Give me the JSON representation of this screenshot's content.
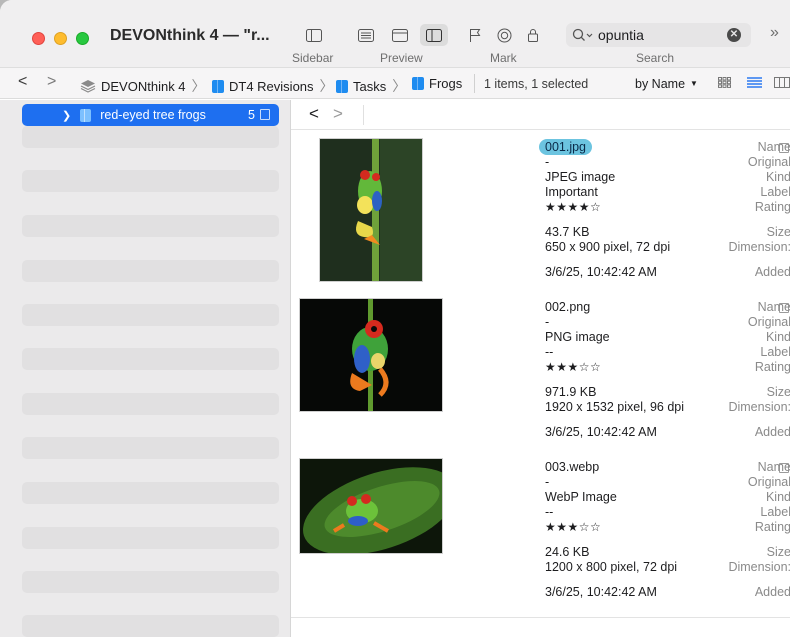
{
  "window": {
    "title": "DEVONthink 4 — \"r..."
  },
  "toolbar": {
    "sidebar_label": "Sidebar",
    "preview_label": "Preview",
    "mark_label": "Mark",
    "search_label": "Search",
    "search_value": "opuntia"
  },
  "pathbar": {
    "crumbs": [
      "DEVONthink 4",
      "DT4 Revisions",
      "Tasks",
      "Frogs"
    ],
    "count": "1 items, 1 selected",
    "sort": "by Name"
  },
  "sidebar": {
    "selected": {
      "label": "red-eyed tree frogs",
      "count": "5"
    }
  },
  "labels": {
    "name": "Name",
    "original": "Original",
    "kind": "Kind",
    "label": "Label",
    "rating": "Rating",
    "size": "Size",
    "dimension": "Dimension:",
    "added": "Added"
  },
  "items": [
    {
      "name": "001.jpg",
      "original": "-",
      "kind": "JPEG image",
      "label": "Important",
      "rating": "★★★★☆",
      "rating_value": 4,
      "size": "43.7 KB",
      "dimension": "650 x 900 pixel, 72 dpi",
      "added": "3/6/25, 10:42:42 AM"
    },
    {
      "name": "002.png",
      "original": "-",
      "kind": "PNG image",
      "label": "--",
      "rating": "★★★☆☆",
      "rating_value": 3,
      "size": "971.9 KB",
      "dimension": "1920 x 1532 pixel, 96 dpi",
      "added": "3/6/25, 10:42:42 AM"
    },
    {
      "name": "003.webp",
      "original": "-",
      "kind": "WebP Image",
      "label": "--",
      "rating": "★★★☆☆",
      "rating_value": 3,
      "size": "24.6 KB",
      "dimension": "1200 x 800 pixel, 72 dpi",
      "added": "3/6/25, 10:42:42 AM"
    }
  ]
}
